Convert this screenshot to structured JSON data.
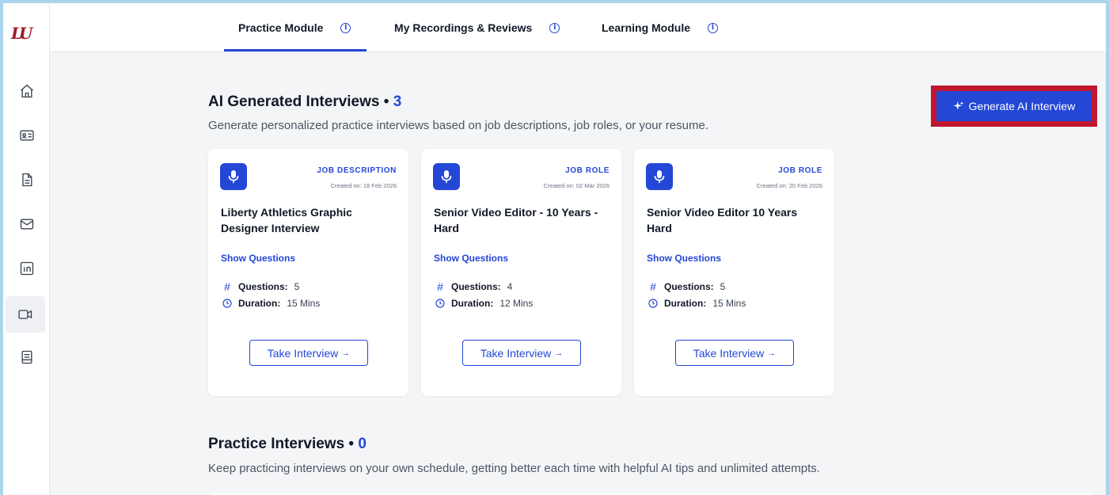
{
  "brand": {
    "logo_text": "LU"
  },
  "sidebar": {
    "items": [
      {
        "icon": "home-icon"
      },
      {
        "icon": "id-card-icon"
      },
      {
        "icon": "document-icon"
      },
      {
        "icon": "mail-icon"
      },
      {
        "icon": "linkedin-icon"
      },
      {
        "icon": "video-icon",
        "active": true
      },
      {
        "icon": "notebook-icon"
      }
    ]
  },
  "topnav": {
    "tabs": [
      {
        "label": "Practice Module",
        "active": true
      },
      {
        "label": "My Recordings & Reviews",
        "active": false
      },
      {
        "label": "Learning Module",
        "active": false
      }
    ],
    "info_glyph": "i"
  },
  "ai_section": {
    "title": "AI Generated Interviews • ",
    "count": "3",
    "subtitle": "Generate personalized practice interviews based on job descriptions, job roles, or your resume.",
    "generate_button": "Generate AI Interview"
  },
  "cards": [
    {
      "type": "JOB DESCRIPTION",
      "created": "Created on: 18 Feb 2026",
      "title": "Liberty Athletics Graphic Designer Interview",
      "show_questions": "Show Questions",
      "questions_label": "Questions:",
      "questions": "5",
      "duration_label": "Duration:",
      "duration": "15 Mins",
      "button": "Take Interview",
      "arrow": "→"
    },
    {
      "type": "JOB ROLE",
      "created": "Created on: 02 Mar 2026",
      "title": "Senior Video Editor - 10 Years - Hard",
      "show_questions": "Show Questions",
      "questions_label": "Questions:",
      "questions": "4",
      "duration_label": "Duration:",
      "duration": "12 Mins",
      "button": "Take Interview",
      "arrow": "→"
    },
    {
      "type": "JOB ROLE",
      "created": "Created on: 20 Feb 2026",
      "title": "Senior Video Editor 10 Years Hard",
      "show_questions": "Show Questions",
      "questions_label": "Questions:",
      "questions": "5",
      "duration_label": "Duration:",
      "duration": "15 Mins",
      "button": "Take Interview",
      "arrow": "→"
    }
  ],
  "practice_section": {
    "title": "Practice Interviews • ",
    "count": "0",
    "subtitle": "Keep practicing interviews on your own schedule, getting better each time with helpful AI tips and unlimited attempts."
  },
  "colors": {
    "accent": "#2447d6",
    "highlight_border": "#c0162e",
    "brand": "#9b1c24"
  }
}
